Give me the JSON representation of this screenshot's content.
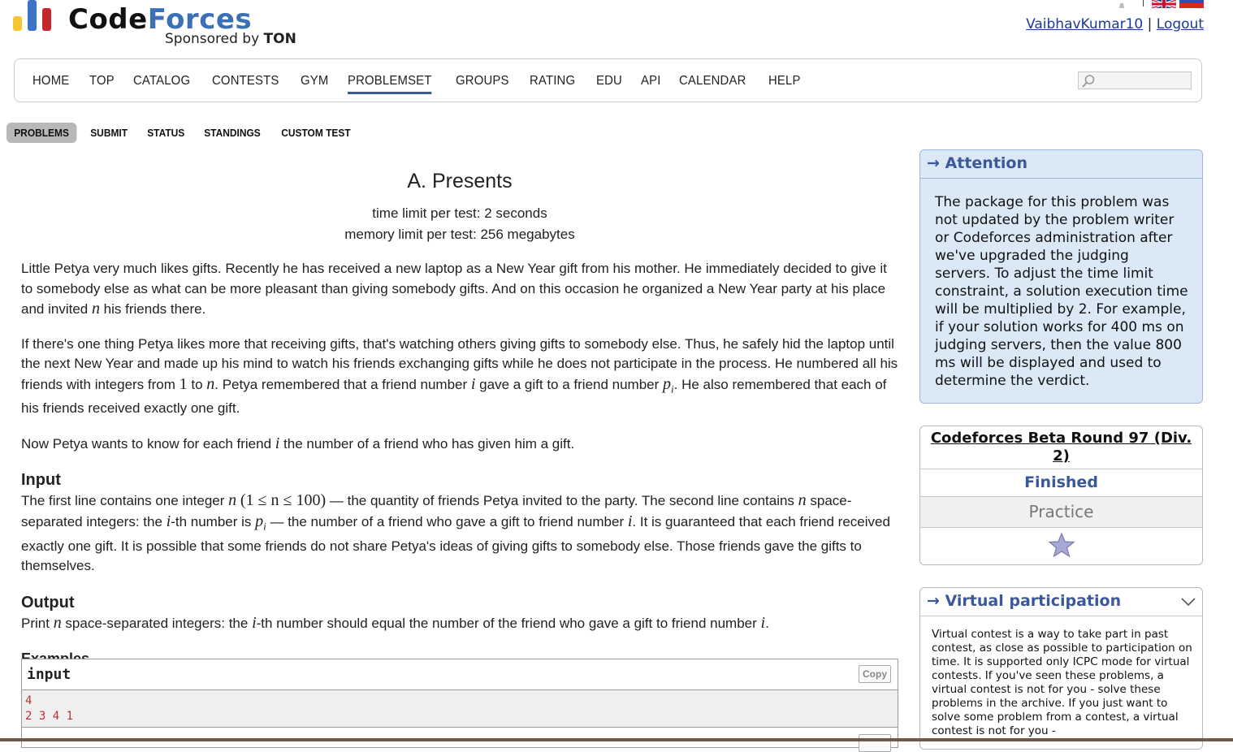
{
  "header": {
    "logo_word_1": "Code",
    "logo_word_2": "Forces",
    "sponsor_prefix": "Sponsored by",
    "sponsor_name": "TON",
    "logo_bar_colors": [
      "#f4c631",
      "#3b74c7",
      "#c3272b"
    ],
    "languages": [
      "en",
      "ru"
    ],
    "user_name": "VaibhavKumar10",
    "separator": "|",
    "logout_label": "Logout"
  },
  "main_menu": {
    "items": [
      "HOME",
      "TOP",
      "CATALOG",
      "CONTESTS",
      "GYM",
      "PROBLEMSET",
      "GROUPS",
      "RATING",
      "EDU",
      "API",
      "CALENDAR",
      "HELP"
    ],
    "active": "PROBLEMSET",
    "search_icon": "magnifier-icon"
  },
  "second_menu": {
    "items": [
      "PROBLEMS",
      "SUBMIT",
      "STATUS",
      "STANDINGS",
      "CUSTOM TEST"
    ],
    "active": "PROBLEMS"
  },
  "problem": {
    "title": "A. Presents",
    "time_limit": "time limit per test: 2 seconds",
    "memory_limit": "memory limit per test: 256 megabytes",
    "legend_p1": {
      "a": "Little Petya very much likes gifts. Recently he has received a new laptop as a New Year gift from his mother. He immediately decided to give it to somebody else as what can be more pleasant than giving somebody gifts. And on this occasion he organized a New Year party at his place and invited ",
      "n": "n",
      "b": " his friends there."
    },
    "legend_p2": {
      "a": "If there's one thing Petya likes more that receiving gifts, that's watching others giving gifts to somebody else. Thus, he safely hid the laptop until the next New Year and made up his mind to watch his friends exchanging gifts while he does not participate in the process. He numbered all his friends with integers from ",
      "one": "1",
      "b": " to ",
      "n": "n",
      "c": ". Petya remembered that a friend number ",
      "i": "i",
      "d": " gave a gift to a friend number ",
      "p": "p",
      "sub": "i",
      "e": ". He also remembered that each of his friends received exactly one gift."
    },
    "legend_p3": {
      "a": "Now Petya wants to know for each friend ",
      "i": "i",
      "b": " the number of a friend who has given him a gift."
    },
    "input_title": "Input",
    "input_text": {
      "a": "The first line contains one integer ",
      "n": "n",
      "constraint": "(1 ≤ n ≤ 100)",
      "b": " — the quantity of friends Petya invited to the party. The second line contains ",
      "n2": "n",
      "c": " space-separated integers: the ",
      "i": "i",
      "d": "-th number is ",
      "p": "p",
      "sub": "i",
      "e": " — the number of a friend who gave a gift to friend number ",
      "i2": "i",
      "f": ". It is guaranteed that each friend received exactly one gift. It is possible that some friends do not share Petya's ideas of giving gifts to somebody else. Those friends gave the gifts to themselves."
    },
    "output_title": "Output",
    "output_text": {
      "a": "Print ",
      "n": "n",
      "b": " space-separated integers: the ",
      "i": "i",
      "c": "-th number should equal the number of the friend who gave a gift to friend number ",
      "i2": "i",
      "d": "."
    },
    "examples_title": "Examples",
    "sample": {
      "input_label": "input",
      "copy_label": "Copy",
      "lines": [
        "4",
        "2 3 4 1"
      ]
    }
  },
  "sidebar": {
    "attention_title": "→ Attention",
    "attention_text": "The package for this problem was not updated by the problem writer or Codeforces administration after we've upgraded the judging servers. To adjust the time limit constraint, a solution execution time will be multiplied by 2. For example, if your solution works for 400 ms on judging servers, then the value 800 ms will be displayed and used to determine the verdict.",
    "contest_name": "Codeforces Beta Round 97 (Div. 2)",
    "contest_status": "Finished",
    "contest_phase": "Practice",
    "star_icon": "star-icon",
    "virtual_title": "→ Virtual participation",
    "virtual_text": "Virtual contest is a way to take part in past contest, as close as possible to participation on time. It is supported only ICPC mode for virtual contests. If you've seen these problems, a virtual contest is not for you - solve these problems in the archive. If you just want to solve some problem from a contest, a virtual contest is not for you -"
  }
}
